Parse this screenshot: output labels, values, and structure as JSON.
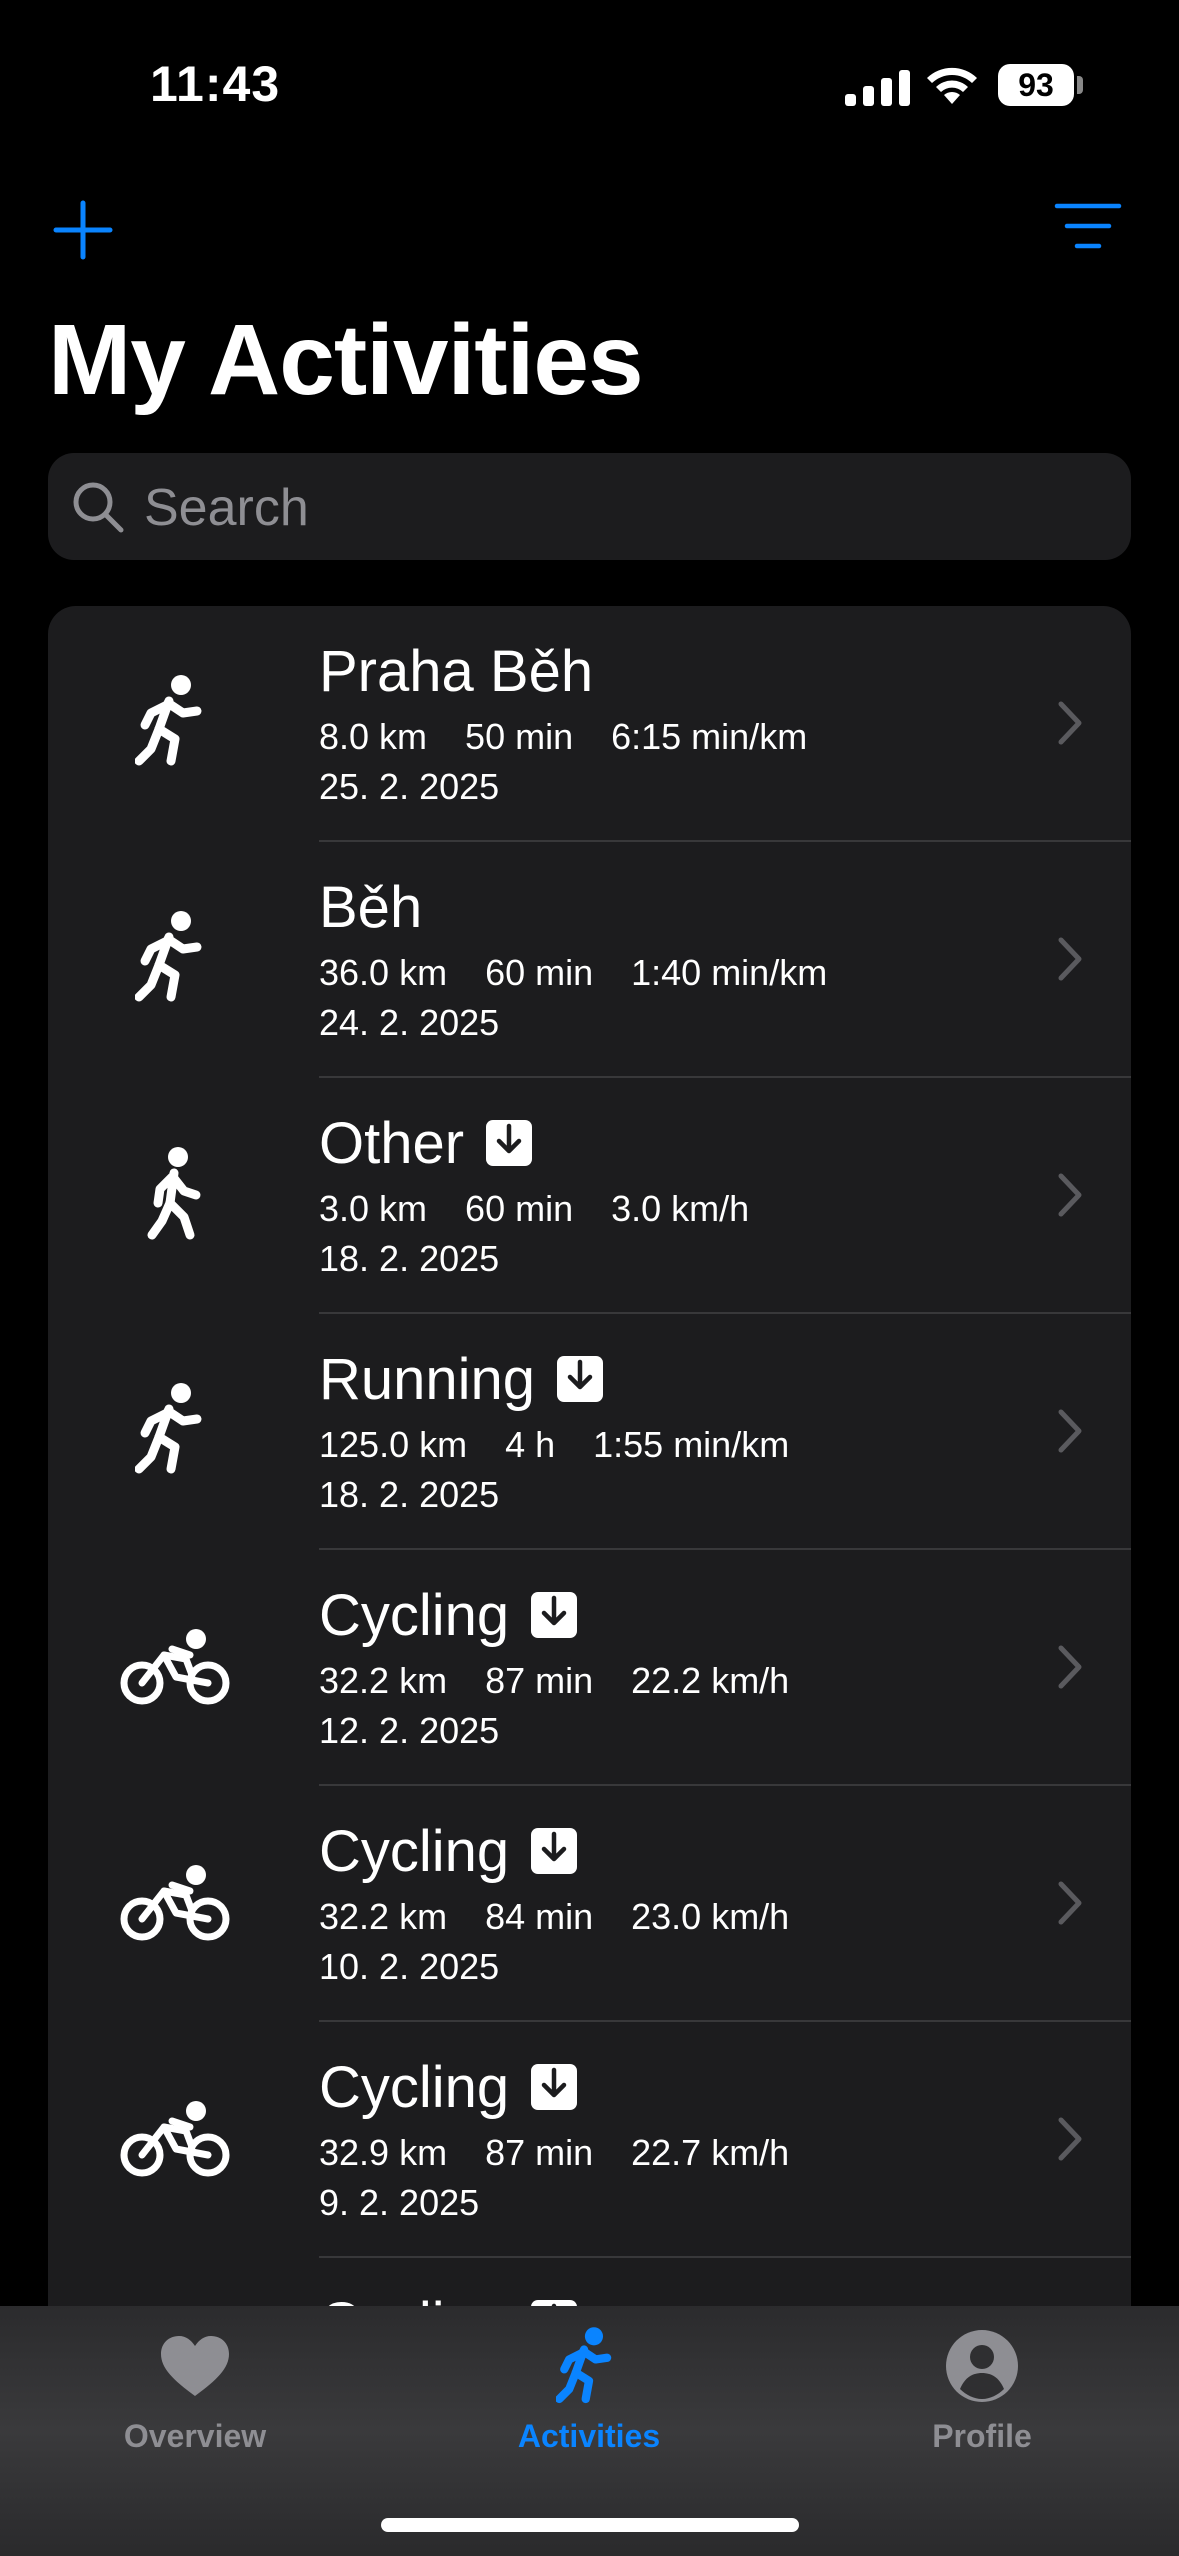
{
  "status_bar": {
    "time": "11:43",
    "battery": "93"
  },
  "header": {
    "title": "My Activities",
    "add_icon": "plus-icon",
    "filter_icon": "filter-lines-icon"
  },
  "search": {
    "placeholder": "Search"
  },
  "colors": {
    "accent": "#0a84ff",
    "background": "#000000",
    "card": "#1c1c1e",
    "secondary_text": "#8e8e93"
  },
  "activities": [
    {
      "icon": "running-icon",
      "title": "Praha Běh",
      "distance": "8.0 km",
      "duration": "50 min",
      "pace": "6:15 min/km",
      "date": "25. 2. 2025",
      "downloaded": false
    },
    {
      "icon": "running-icon",
      "title": "Běh",
      "distance": "36.0 km",
      "duration": "60 min",
      "pace": "1:40 min/km",
      "date": "24. 2. 2025",
      "downloaded": false
    },
    {
      "icon": "walking-icon",
      "title": "Other",
      "distance": "3.0 km",
      "duration": "60 min",
      "pace": "3.0 km/h",
      "date": "18. 2. 2025",
      "downloaded": true
    },
    {
      "icon": "running-icon",
      "title": "Running",
      "distance": "125.0 km",
      "duration": "4 h",
      "pace": "1:55 min/km",
      "date": "18. 2. 2025",
      "downloaded": true
    },
    {
      "icon": "cycling-icon",
      "title": "Cycling",
      "distance": "32.2 km",
      "duration": "87 min",
      "pace": "22.2 km/h",
      "date": "12. 2. 2025",
      "downloaded": true
    },
    {
      "icon": "cycling-icon",
      "title": "Cycling",
      "distance": "32.2 km",
      "duration": "84 min",
      "pace": "23.0 km/h",
      "date": "10. 2. 2025",
      "downloaded": true
    },
    {
      "icon": "cycling-icon",
      "title": "Cycling",
      "distance": "32.9 km",
      "duration": "87 min",
      "pace": "22.7 km/h",
      "date": "9. 2. 2025",
      "downloaded": true
    },
    {
      "icon": "cycling-icon",
      "title": "Cycling",
      "distance": "",
      "duration": "",
      "pace": "",
      "date": "",
      "downloaded": true
    }
  ],
  "tabs": [
    {
      "label": "Overview",
      "icon": "heart-icon",
      "active": false
    },
    {
      "label": "Activities",
      "icon": "running-icon",
      "active": true
    },
    {
      "label": "Profile",
      "icon": "person-circle-icon",
      "active": false
    }
  ]
}
